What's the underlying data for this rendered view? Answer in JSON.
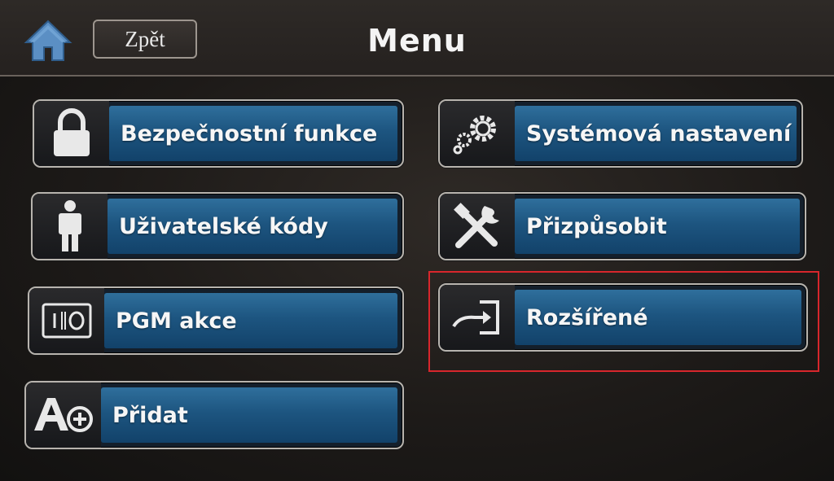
{
  "header": {
    "title": "Menu",
    "back_label": "Zpět",
    "home_icon": "home-icon"
  },
  "menu": {
    "left": [
      {
        "label": "Bezpečnostní funkce",
        "icon": "lock-icon"
      },
      {
        "label": "Uživatelské kódy",
        "icon": "user-icon"
      },
      {
        "label": "PGM akce",
        "icon": "pgm-switch-icon"
      },
      {
        "label": "Přidat",
        "icon": "add-icon"
      }
    ],
    "right": [
      {
        "label": "Systémová nastavení",
        "icon": "gears-icon"
      },
      {
        "label": "Přizpůsobit",
        "icon": "tools-icon"
      },
      {
        "label": "Rozšířené",
        "icon": "enter-icon"
      }
    ]
  },
  "colors": {
    "tile_blue": "#1d5580",
    "highlight": "#d8262c",
    "header_bg": "#2a2623"
  }
}
